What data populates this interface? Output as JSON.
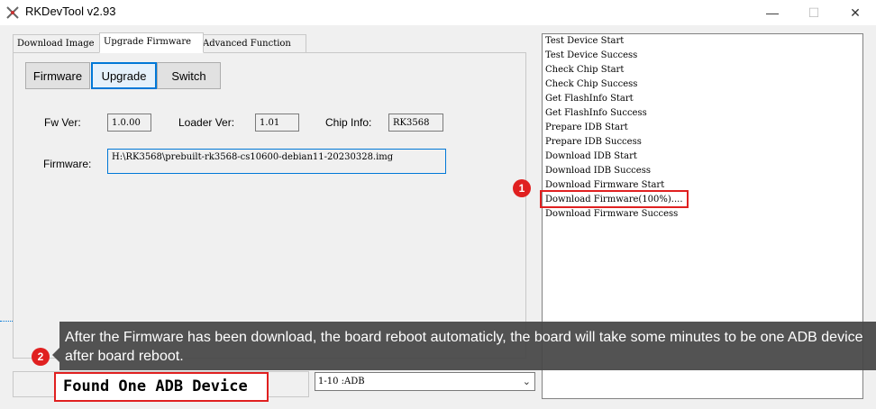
{
  "window": {
    "title": "RKDevTool v2.93",
    "controls": {
      "minimize": "—",
      "maximize": "☐",
      "close": "✕"
    }
  },
  "tabs": [
    {
      "label": "Download Image"
    },
    {
      "label": "Upgrade Firmware"
    },
    {
      "label": "Advanced Function"
    }
  ],
  "buttons": {
    "firmware": "Firmware",
    "upgrade": "Upgrade",
    "switch": "Switch"
  },
  "info": {
    "fw_ver_label": "Fw Ver:",
    "fw_ver_value": "1.0.00",
    "loader_ver_label": "Loader Ver:",
    "loader_ver_value": "1.01",
    "chip_info_label": "Chip Info:",
    "chip_info_value": "RK3568",
    "firmware_label": "Firmware:",
    "firmware_path": "H:\\RK3568\\prebuilt-rk3568-cs10600-debian11-20230328.img"
  },
  "log": [
    "Test Device Start",
    "Test Device Success",
    "Check Chip Start",
    " Check Chip Success",
    "Get FlashInfo Start",
    "Get FlashInfo Success",
    "Prepare IDB Start",
    "Prepare IDB Success",
    "Download IDB Start",
    "Download IDB Success",
    "Download Firmware Start",
    "Download Firmware(100%)....",
    "Download Firmware Success"
  ],
  "annotations": {
    "badge1": "1",
    "badge2": "2",
    "callout_text": "After the Firmware has been download, the board reboot automaticly, the board will take some minutes to be one ADB device after board reboot."
  },
  "status": {
    "message": "Found One ADB Device"
  },
  "device_select": {
    "value": "1-10 :ADB"
  },
  "colors": {
    "accent": "#0078d7",
    "highlight": "#e02020",
    "callout_bg": "#464646"
  }
}
